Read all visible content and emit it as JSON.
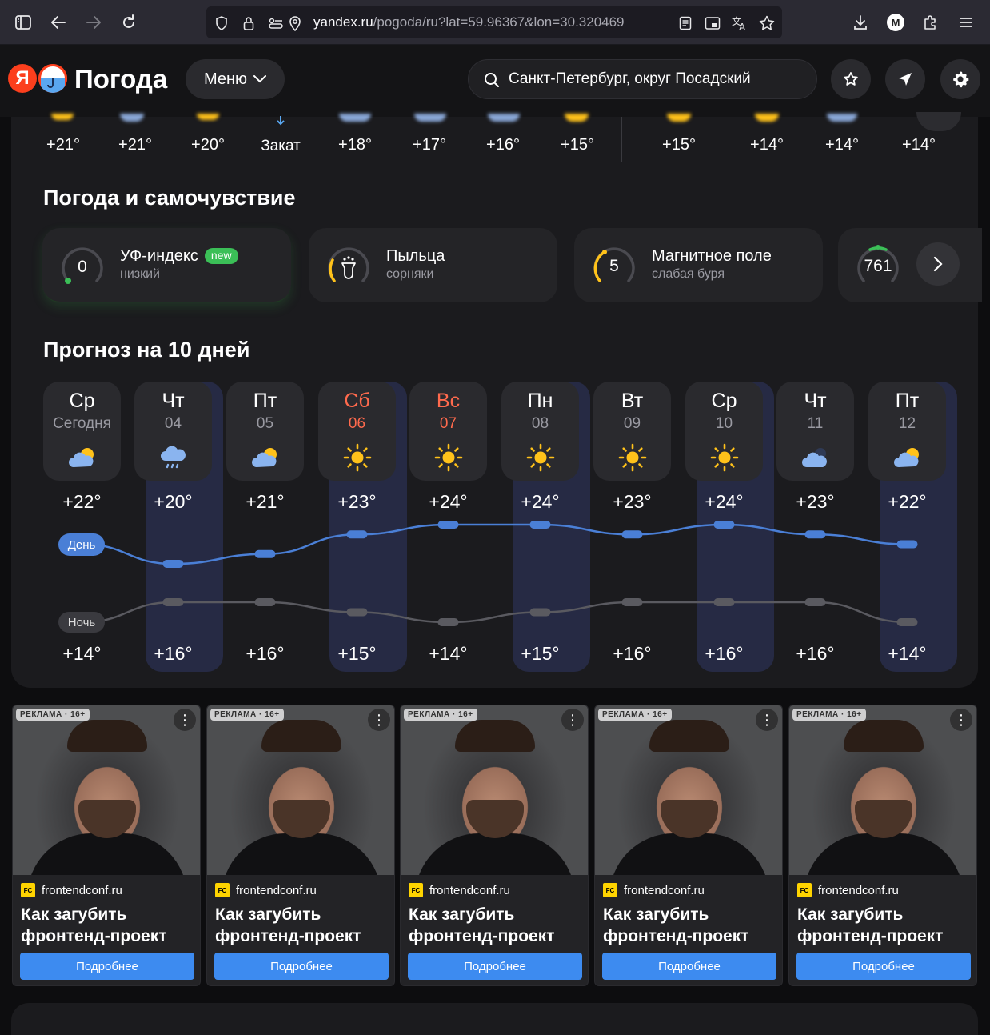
{
  "browser": {
    "url_host": "yandex.ru",
    "url_path": "/pogoda/ru?lat=59.96367&lon=30.320469",
    "profile_initial": "M"
  },
  "header": {
    "logo_ya": "Я",
    "logo_text": "Погода",
    "menu_label": "Меню",
    "search_value": "Санкт-Петербург, округ Посадский"
  },
  "hourly": {
    "items": [
      "+21°",
      "+21°",
      "+20°",
      "Закат",
      "+18°",
      "+17°",
      "+16°",
      "+15°",
      "+15°",
      "+14°",
      "+14°",
      "+14°"
    ]
  },
  "wellbeing": {
    "title": "Погода и самочувствие",
    "cards": [
      {
        "title": "УФ-индекс",
        "badge": "new",
        "sub": "низкий",
        "value": "0"
      },
      {
        "title": "Пыльца",
        "sub": "сорняки",
        "value": ""
      },
      {
        "title": "Магнитное поле",
        "sub": "слабая буря",
        "value": "5"
      },
      {
        "title": "",
        "sub": "",
        "value": "761"
      }
    ]
  },
  "forecast": {
    "title": "Прогноз на 10 дней",
    "day_label": "День",
    "night_label": "Ночь",
    "days": [
      {
        "name": "Ср",
        "date": "Сегодня",
        "icon": "partly-cloudy-icon",
        "max": "+22°",
        "min": "+14°",
        "weekend": false
      },
      {
        "name": "Чт",
        "date": "04",
        "icon": "rain-cloud-icon",
        "max": "+20°",
        "min": "+16°",
        "weekend": false
      },
      {
        "name": "Пт",
        "date": "05",
        "icon": "partly-cloudy-icon",
        "max": "+21°",
        "min": "+16°",
        "weekend": false
      },
      {
        "name": "Сб",
        "date": "06",
        "icon": "sun-icon",
        "max": "+23°",
        "min": "+15°",
        "weekend": true
      },
      {
        "name": "Вс",
        "date": "07",
        "icon": "sun-icon",
        "max": "+24°",
        "min": "+14°",
        "weekend": true
      },
      {
        "name": "Пн",
        "date": "08",
        "icon": "sun-icon",
        "max": "+24°",
        "min": "+15°",
        "weekend": false
      },
      {
        "name": "Вт",
        "date": "09",
        "icon": "sun-icon",
        "max": "+23°",
        "min": "+16°",
        "weekend": false
      },
      {
        "name": "Ср",
        "date": "10",
        "icon": "sun-icon",
        "max": "+24°",
        "min": "+16°",
        "weekend": false
      },
      {
        "name": "Чт",
        "date": "11",
        "icon": "cloud-icon",
        "max": "+23°",
        "min": "+16°",
        "weekend": false
      },
      {
        "name": "Пт",
        "date": "12",
        "icon": "partly-cloudy-icon",
        "max": "+22°",
        "min": "+14°",
        "weekend": false
      }
    ],
    "day_temps": [
      22,
      20,
      21,
      23,
      24,
      24,
      23,
      24,
      23,
      22
    ],
    "night_temps": [
      14,
      16,
      16,
      15,
      14,
      15,
      16,
      16,
      16,
      14
    ]
  },
  "ads": [
    {
      "label": "РЕКЛАМА · 16+",
      "source": "frontendconf.ru",
      "logo": "FC",
      "title": "Как загубить фронтенд-проект",
      "button": "Подробнее"
    },
    {
      "label": "РЕКЛАМА · 16+",
      "source": "frontendconf.ru",
      "logo": "FC",
      "title": "Как загубить фронтенд-проект",
      "button": "Подробнее"
    },
    {
      "label": "РЕКЛАМА · 16+",
      "source": "frontendconf.ru",
      "logo": "FC",
      "title": "Как загубить фронтенд-проект",
      "button": "Подробнее"
    },
    {
      "label": "РЕКЛАМА · 16+",
      "source": "frontendconf.ru",
      "logo": "FC",
      "title": "Как загубить фронтенд-проект",
      "button": "Подробнее"
    },
    {
      "label": "РЕКЛАМА · 16+",
      "source": "frontendconf.ru",
      "logo": "FC",
      "title": "Как загубить фронтенд-проект",
      "button": "Подробнее"
    }
  ],
  "colors": {
    "accent_blue": "#4a7fd6",
    "weekend": "#ff6a4d",
    "uv_green": "#3bbf57",
    "sun": "#ffc21a"
  }
}
